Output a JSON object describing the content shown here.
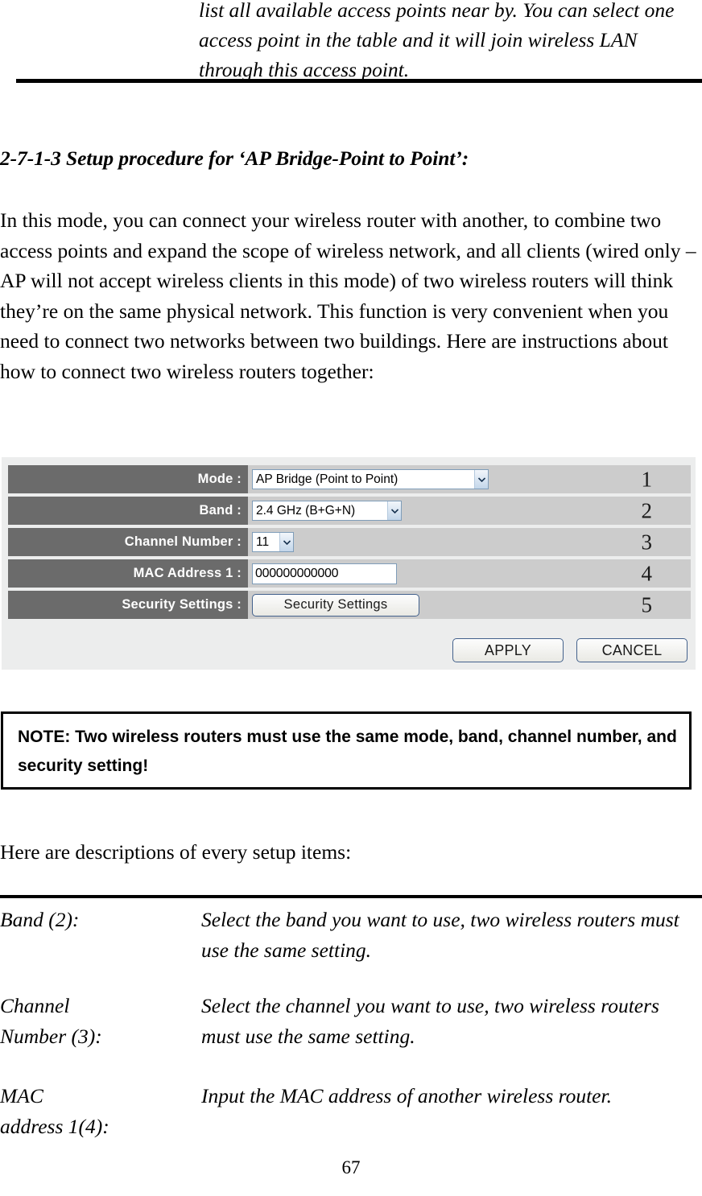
{
  "quote": "list all available access points near by. You can select one access point in the table and it will join wireless LAN through this access point.",
  "heading": "2-7-1-3 Setup procedure for ‘AP Bridge-Point to Point’:",
  "body_paragraph": "In this mode, you can connect your wireless router with another, to combine two access points and expand the scope of wireless network, and all clients (wired only – AP will not accept wireless clients in this mode) of two wireless routers will think they’re on the same physical network. This function is very convenient when you need to connect two networks between two buildings. Here are instructions about how to connect two wireless routers together:",
  "ui_panel": {
    "rows": [
      {
        "label": "Mode :",
        "control": "select",
        "value": "AP Bridge (Point to Point)",
        "marker": "1"
      },
      {
        "label": "Band :",
        "control": "select",
        "value": "2.4 GHz (B+G+N)",
        "marker": "2"
      },
      {
        "label": "Channel Number :",
        "control": "select",
        "value": "11",
        "marker": "3"
      },
      {
        "label": "MAC Address 1 :",
        "control": "text",
        "value": "000000000000",
        "marker": "4"
      },
      {
        "label": "Security Settings :",
        "control": "button",
        "value": "Security Settings",
        "marker": "5"
      }
    ],
    "apply_label": "APPLY",
    "cancel_label": "CANCEL",
    "colors": {
      "label_bg": "#6b6b6b",
      "field_bg": "#cccccc",
      "panel_bg": "#eceded",
      "control_border": "#7f9db9",
      "button_border": "#43618c"
    }
  },
  "note": "NOTE: Two wireless routers must use the same mode, band, channel number, and security setting!",
  "lead_line": "Here are descriptions of every setup items:",
  "descriptions": [
    {
      "term": "Band (2):",
      "definition": "Select the band you want to use, two wireless routers must use the same setting."
    },
    {
      "term": "Channel\nNumber (3):",
      "definition": "Select the channel you want to use, two wireless routers must use the same setting."
    },
    {
      "term": "MAC\naddress 1(4):",
      "definition": "Input the MAC address of another wireless router."
    }
  ],
  "page_number": "67"
}
